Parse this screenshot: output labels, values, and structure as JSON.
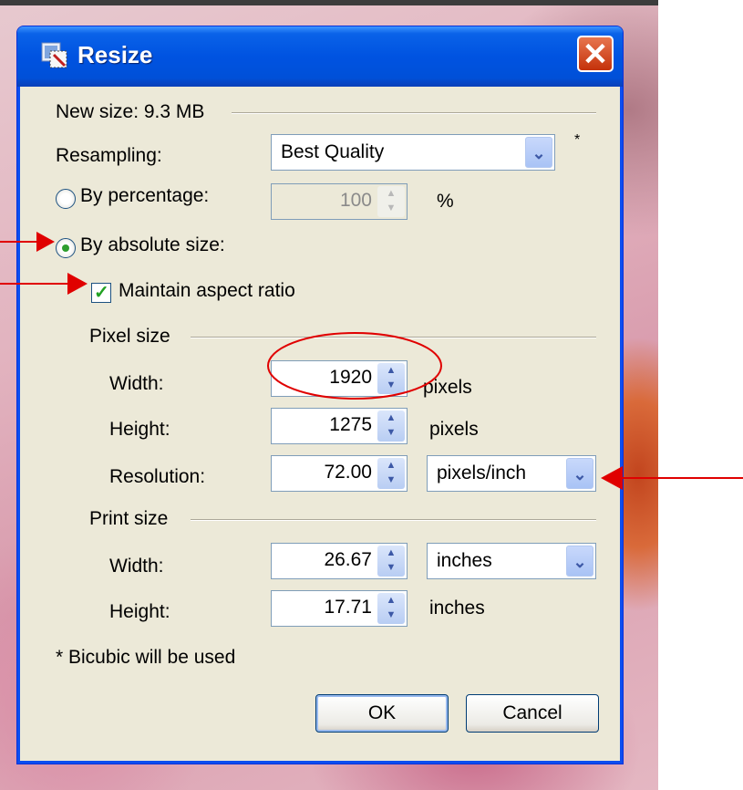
{
  "window": {
    "title": "Resize",
    "close_label": "✕"
  },
  "new_size": "New size: 9.3 MB",
  "resampling": {
    "label": "Resampling:",
    "value": "Best Quality",
    "note": "*"
  },
  "by_percentage": {
    "label": "By percentage:",
    "value": "100",
    "unit": "%",
    "selected": false
  },
  "by_absolute": {
    "label": "By absolute size:",
    "selected": true
  },
  "maintain_aspect": {
    "label": "Maintain aspect ratio",
    "checked": true
  },
  "pixel_size": {
    "header": "Pixel size",
    "width": {
      "label": "Width:",
      "value": "1920",
      "unit": "pixels"
    },
    "height": {
      "label": "Height:",
      "value": "1275",
      "unit": "pixels"
    },
    "resolution": {
      "label": "Resolution:",
      "value": "72.00",
      "unit": "pixels/inch"
    }
  },
  "print_size": {
    "header": "Print size",
    "width": {
      "label": "Width:",
      "value": "26.67",
      "unit": "inches"
    },
    "height": {
      "label": "Height:",
      "value": "17.71",
      "unit": "inches"
    }
  },
  "footnote": "* Bicubic will be used",
  "buttons": {
    "ok": "OK",
    "cancel": "Cancel"
  },
  "colors": {
    "annotation_red": "#e00000",
    "titlebar_blue": "#0053e1"
  }
}
